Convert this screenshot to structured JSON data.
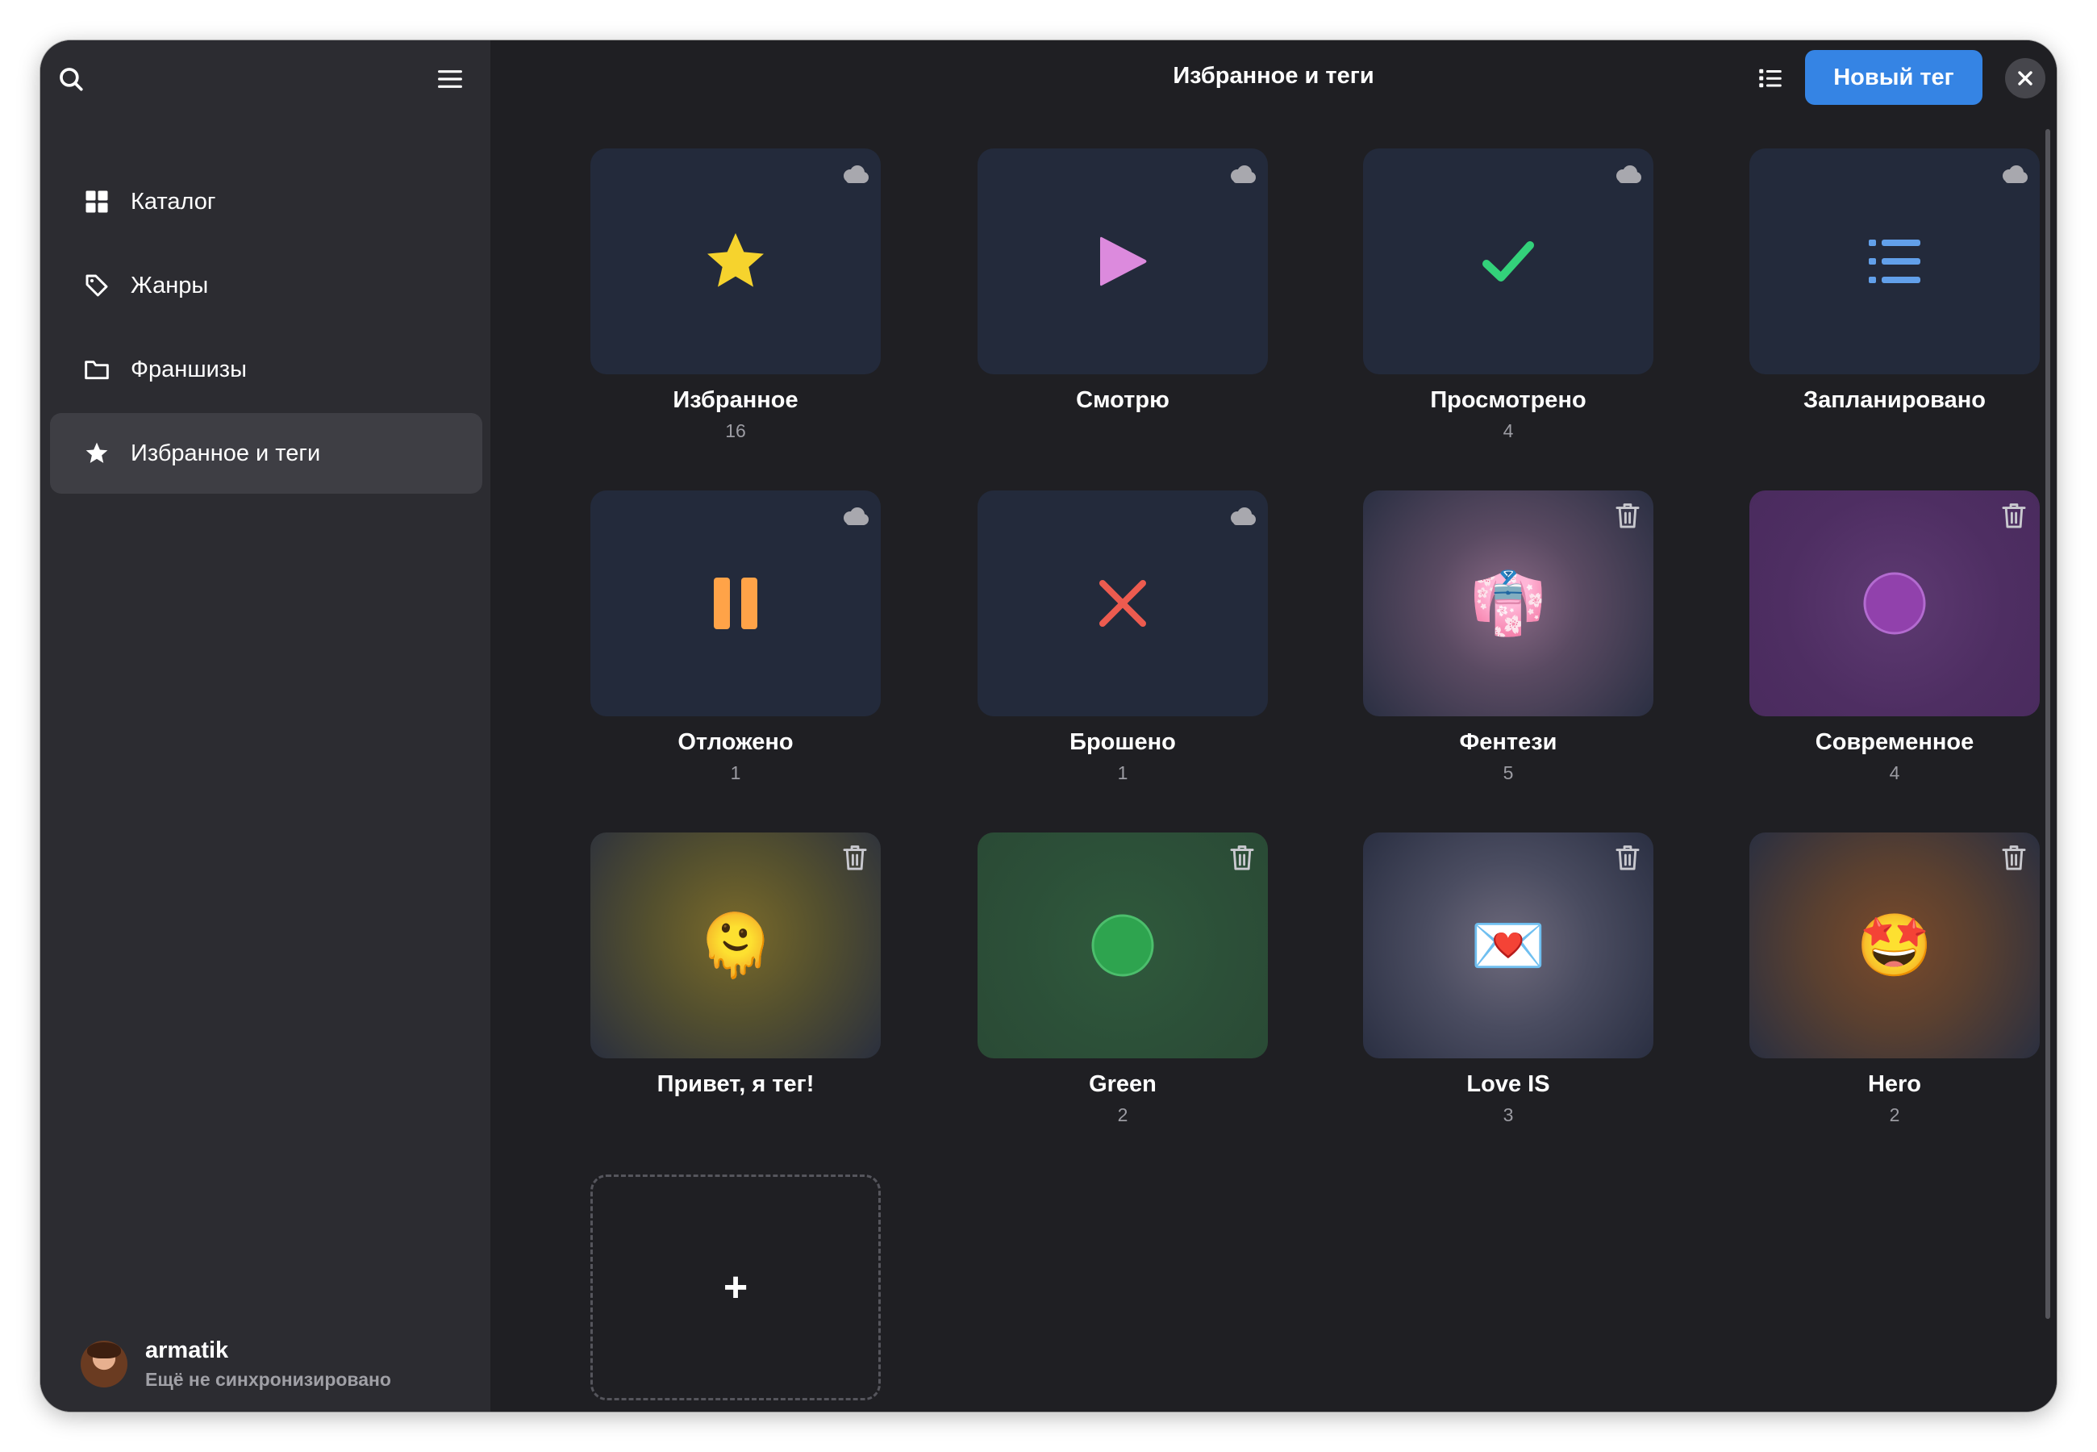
{
  "sidebar": {
    "nav": [
      {
        "label": "Каталог",
        "icon": "grid-icon"
      },
      {
        "label": "Жанры",
        "icon": "tag-icon"
      },
      {
        "label": "Франшизы",
        "icon": "folder-icon"
      },
      {
        "label": "Избранное и теги",
        "icon": "star-icon",
        "active": true
      }
    ],
    "user": {
      "name": "armatik",
      "status": "Ещё не синхронизировано"
    }
  },
  "header": {
    "title": "Избранное и теги",
    "new_tag_label": "Новый тег"
  },
  "tags": [
    {
      "label": "Избранное",
      "count": "16",
      "icon": "star-icon",
      "corner": "cloud-icon"
    },
    {
      "label": "Смотрю",
      "count": "",
      "icon": "play-icon",
      "corner": "cloud-icon"
    },
    {
      "label": "Просмотрено",
      "count": "4",
      "icon": "check-icon",
      "corner": "cloud-icon"
    },
    {
      "label": "Запланировано",
      "count": "",
      "icon": "list-icon",
      "corner": "cloud-icon"
    },
    {
      "label": "Отложено",
      "count": "1",
      "icon": "pause-icon",
      "corner": "cloud-icon"
    },
    {
      "label": "Брошено",
      "count": "1",
      "icon": "cross-icon",
      "corner": "cloud-icon"
    },
    {
      "label": "Фентези",
      "count": "5",
      "emoji": "👘",
      "corner": "trash-icon"
    },
    {
      "label": "Современное",
      "count": "4",
      "icon": "purple-circle-icon",
      "corner": "trash-icon"
    },
    {
      "label": "Привет, я тег!",
      "count": "",
      "emoji": "🫠",
      "corner": "trash-icon"
    },
    {
      "label": "Green",
      "count": "2",
      "icon": "green-circle-icon",
      "corner": "trash-icon"
    },
    {
      "label": "Love IS",
      "count": "3",
      "emoji": "💌",
      "corner": "trash-icon"
    },
    {
      "label": "Hero",
      "count": "2",
      "emoji": "🤩",
      "corner": "trash-icon"
    }
  ],
  "add_tile": {
    "label": "+"
  },
  "colors": {
    "accent": "#3584e4",
    "star": "#f6d32d",
    "play": "#dc8add",
    "check": "#33d17a",
    "list": "#62a0ea",
    "pause": "#ffa348",
    "cross": "#ed5b4f",
    "purple": "#9141ac",
    "green": "#2ec27e"
  }
}
